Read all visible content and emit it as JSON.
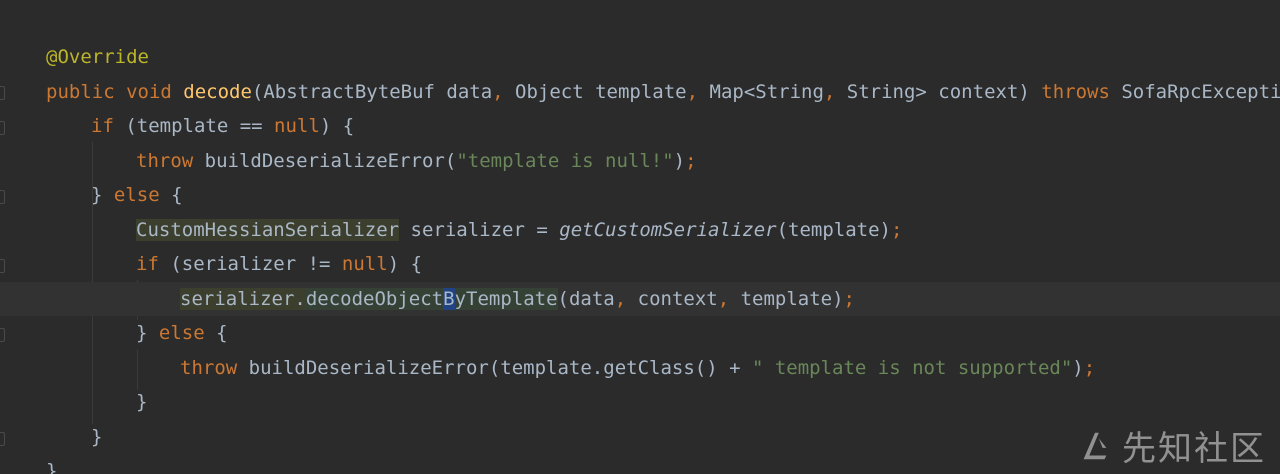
{
  "editor": {
    "lines": [
      {
        "segments": [
          {
            "t": "@Override",
            "c": "ann"
          }
        ]
      },
      {
        "segments": [
          {
            "t": "public void ",
            "c": "kw"
          },
          {
            "t": "decode",
            "c": "fn"
          },
          {
            "t": "(AbstractByteBuf data",
            "c": ""
          },
          {
            "t": ", ",
            "c": "sep"
          },
          {
            "t": "Object template",
            "c": ""
          },
          {
            "t": ", ",
            "c": "sep"
          },
          {
            "t": "Map<String",
            "c": ""
          },
          {
            "t": ", ",
            "c": "sep"
          },
          {
            "t": "String> context) ",
            "c": ""
          },
          {
            "t": "throws ",
            "c": "kw"
          },
          {
            "t": "SofaRpcException",
            "c": ""
          }
        ]
      },
      {
        "segments": [
          {
            "t": "if ",
            "c": "kw"
          },
          {
            "t": "(template == ",
            "c": ""
          },
          {
            "t": "null",
            "c": "kw"
          },
          {
            "t": ") {",
            "c": ""
          }
        ]
      },
      {
        "segments": [
          {
            "t": "throw ",
            "c": "kw"
          },
          {
            "t": "buildDeserializeError(",
            "c": ""
          },
          {
            "t": "\"template is null!\"",
            "c": "str"
          },
          {
            "t": ")",
            "c": ""
          },
          {
            "t": ";",
            "c": "sep"
          }
        ]
      },
      {
        "segments": [
          {
            "t": "} ",
            "c": ""
          },
          {
            "t": "else ",
            "c": "kw"
          },
          {
            "t": "{",
            "c": ""
          }
        ]
      },
      {
        "segments": [
          {
            "t": "CustomHessianSerializer",
            "c": "type-hl"
          },
          {
            "t": " serializer = ",
            "c": ""
          },
          {
            "t": "getCustomSerializer",
            "c": "it"
          },
          {
            "t": "(template)",
            "c": ""
          },
          {
            "t": ";",
            "c": "sep"
          }
        ]
      },
      {
        "segments": [
          {
            "t": "if ",
            "c": "kw"
          },
          {
            "t": "(serializer != ",
            "c": ""
          },
          {
            "t": "null",
            "c": "kw"
          },
          {
            "t": ") {",
            "c": ""
          }
        ]
      },
      {
        "segments": [
          {
            "t": "serializer.",
            "c": "type-hl"
          },
          {
            "t": "decodeObject",
            "c": "call-hl"
          },
          {
            "t": "B",
            "c": "cursor-ch"
          },
          {
            "t": "yTemplate",
            "c": "call-hl"
          },
          {
            "t": "(data",
            "c": ""
          },
          {
            "t": ", ",
            "c": "sep"
          },
          {
            "t": "context",
            "c": ""
          },
          {
            "t": ", ",
            "c": "sep"
          },
          {
            "t": "template)",
            "c": ""
          },
          {
            "t": ";",
            "c": "sep"
          }
        ]
      },
      {
        "segments": [
          {
            "t": "} ",
            "c": ""
          },
          {
            "t": "else ",
            "c": "kw"
          },
          {
            "t": "{",
            "c": ""
          }
        ]
      },
      {
        "segments": [
          {
            "t": "throw ",
            "c": "kw"
          },
          {
            "t": "buildDeserializeError(template.getClass() + ",
            "c": ""
          },
          {
            "t": "\" template is not supported\"",
            "c": "str"
          },
          {
            "t": ")",
            "c": ""
          },
          {
            "t": ";",
            "c": "sep"
          }
        ]
      },
      {
        "segments": [
          {
            "t": "}",
            "c": ""
          }
        ]
      },
      {
        "segments": [
          {
            "t": "}",
            "c": ""
          }
        ]
      },
      {
        "segments": [
          {
            "t": "}",
            "c": ""
          }
        ]
      }
    ],
    "current_line": 7
  },
  "watermark": {
    "text": "先知社区",
    "logo": "xianzhi-logo"
  },
  "colors": {
    "background": "#2b2b2b",
    "keyword": "#cc7832",
    "annotation": "#bbb529",
    "function": "#ffc66d",
    "string": "#6a8759",
    "text": "#a9b7c6"
  }
}
